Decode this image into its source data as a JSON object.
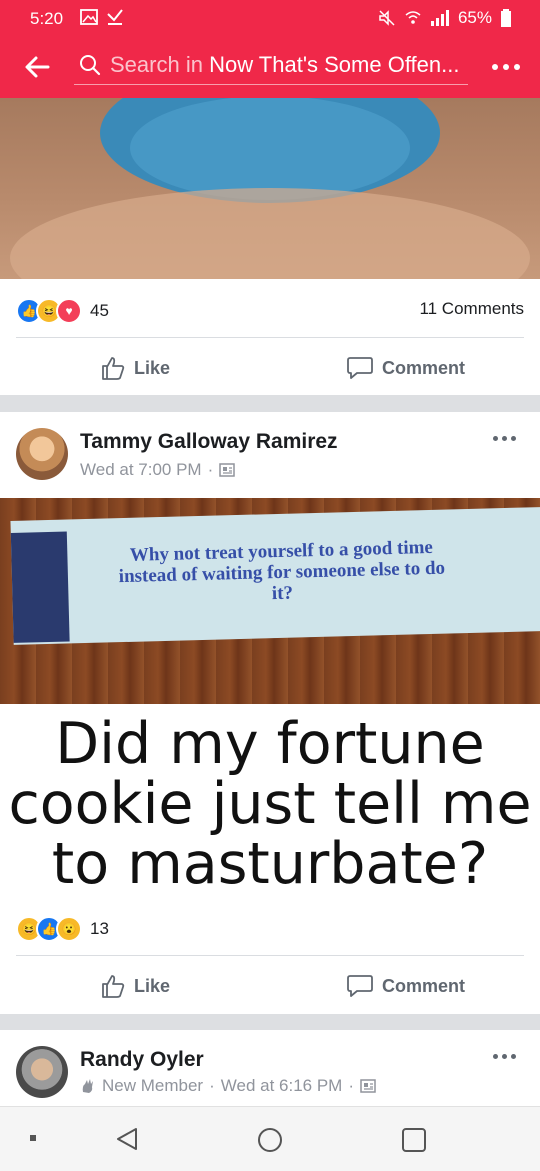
{
  "status": {
    "time": "5:20",
    "battery": "65%"
  },
  "search": {
    "prefix": "Search in",
    "group": "Now That's Some Offen..."
  },
  "post1": {
    "reaction_count": "45",
    "comments": "11 Comments",
    "like": "Like",
    "comment": "Comment"
  },
  "post2": {
    "author": "Tammy Galloway Ramirez",
    "time": "Wed at 7:00 PM",
    "fortune_text": "Why not treat yourself to a good time instead of waiting for someone else to do it?",
    "caption": "Did my fortune cookie just tell me to masturbate?",
    "reaction_count": "13",
    "like": "Like",
    "comment": "Comment"
  },
  "post3": {
    "author": "Randy Oyler",
    "badge": "New Member",
    "time": "Wed at 6:16 PM"
  },
  "colors": {
    "brand": "#f02849",
    "like_blue": "#1877f2"
  },
  "icons": [
    "back-arrow-icon",
    "search-icon",
    "more-icon",
    "like-icon",
    "comment-icon",
    "privacy-icon"
  ]
}
